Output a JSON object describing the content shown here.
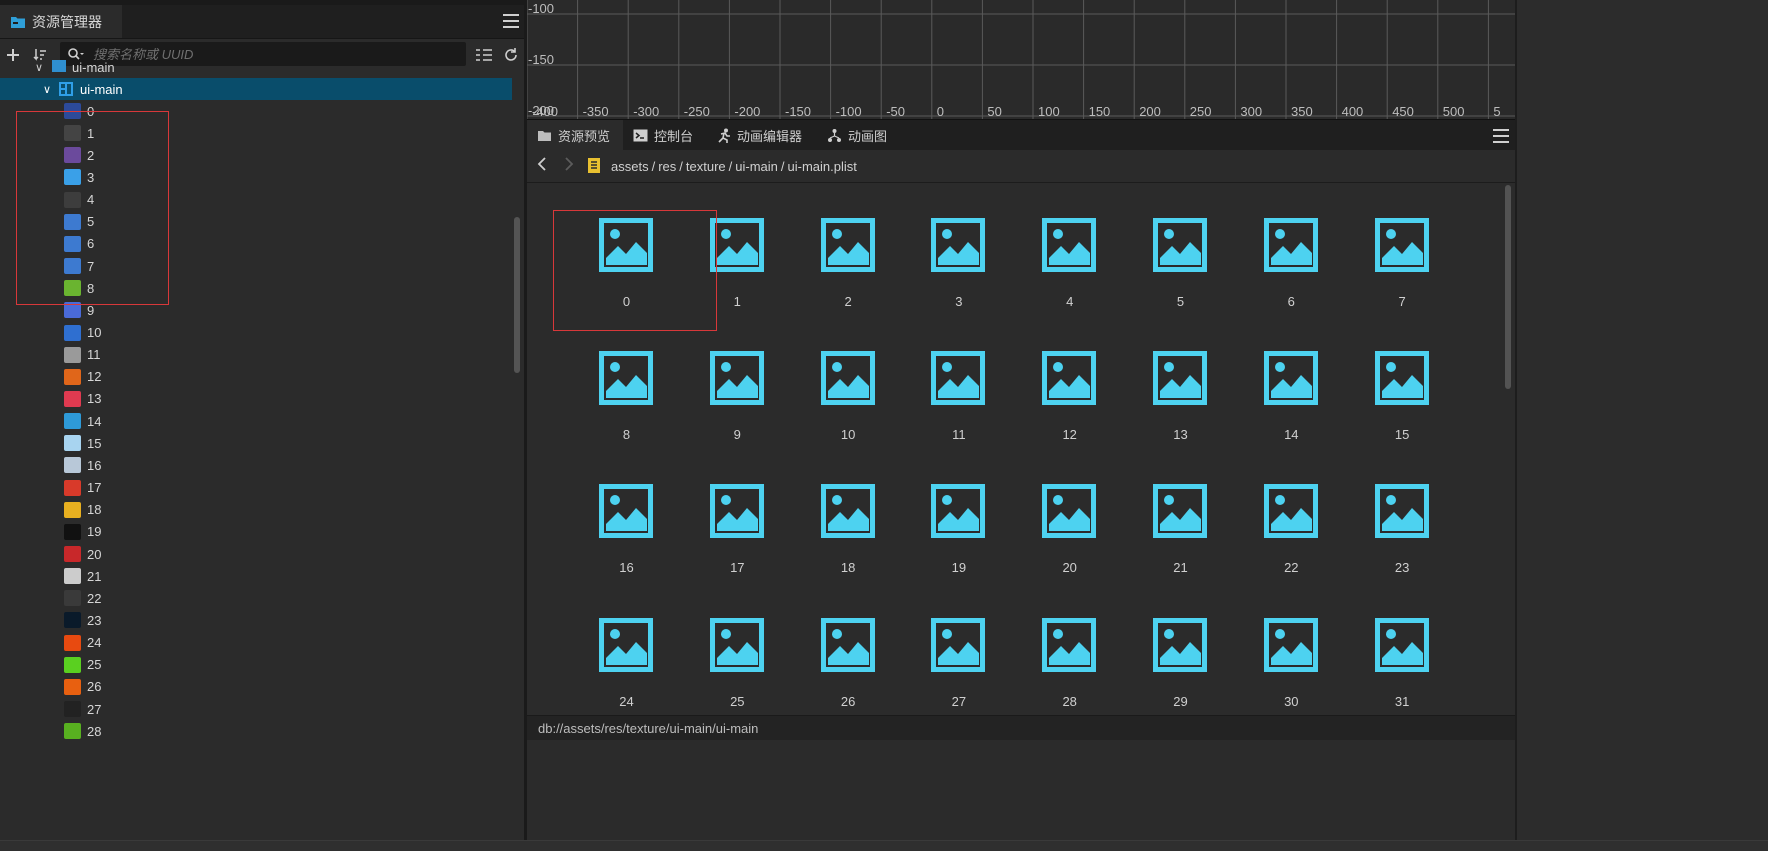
{
  "explorer": {
    "tab_title": "资源管理器",
    "search_placeholder": "搜索名称或 UUID",
    "partial_row_label": "ui-main",
    "selected_label": "ui-main",
    "items": [
      {
        "label": "0",
        "thumb": "#2c4a9a"
      },
      {
        "label": "1",
        "thumb": "#444444"
      },
      {
        "label": "2",
        "thumb": "#6b4a9c"
      },
      {
        "label": "3",
        "thumb": "#3aa0e8"
      },
      {
        "label": "4",
        "thumb": "#3d3d3d"
      },
      {
        "label": "5",
        "thumb": "#3d7ad0"
      },
      {
        "label": "6",
        "thumb": "#3d7ad0"
      },
      {
        "label": "7",
        "thumb": "#3d7ad0"
      },
      {
        "label": "8",
        "thumb": "#6ab430"
      },
      {
        "label": "9",
        "thumb": "#4a6ad8"
      },
      {
        "label": "10",
        "thumb": "#2f6fd0"
      },
      {
        "label": "11",
        "thumb": "#9a9a9a"
      },
      {
        "label": "12",
        "thumb": "#e0661a"
      },
      {
        "label": "13",
        "thumb": "#e03a50"
      },
      {
        "label": "14",
        "thumb": "#2e9ad8"
      },
      {
        "label": "15",
        "thumb": "#a8d4f0"
      },
      {
        "label": "16",
        "thumb": "#b8c8d8"
      },
      {
        "label": "17",
        "thumb": "#d83a2a"
      },
      {
        "label": "18",
        "thumb": "#e8b020"
      },
      {
        "label": "19",
        "thumb": "#111111"
      },
      {
        "label": "20",
        "thumb": "#c8282a"
      },
      {
        "label": "21",
        "thumb": "#cccccc"
      },
      {
        "label": "22",
        "thumb": "#3a3a3a"
      },
      {
        "label": "23",
        "thumb": "#0a1a2a"
      },
      {
        "label": "24",
        "thumb": "#e84a10"
      },
      {
        "label": "25",
        "thumb": "#5ad020"
      },
      {
        "label": "26",
        "thumb": "#e86010"
      },
      {
        "label": "27",
        "thumb": "#222222"
      },
      {
        "label": "28",
        "thumb": "#58b020"
      }
    ]
  },
  "scene": {
    "y_labels": [
      "-100",
      "-150",
      "-200"
    ],
    "x_labels": [
      "-400",
      "-350",
      "-300",
      "-250",
      "-200",
      "-150",
      "-100",
      "-50",
      "0",
      "50",
      "100",
      "150",
      "200",
      "250",
      "300",
      "350",
      "400",
      "450",
      "500",
      "5"
    ]
  },
  "preview": {
    "tabs": [
      {
        "label": "资源预览",
        "icon": "folder-icon"
      },
      {
        "label": "控制台",
        "icon": "terminal-icon"
      },
      {
        "label": "动画编辑器",
        "icon": "runner-icon"
      },
      {
        "label": "动画图",
        "icon": "graph-icon"
      }
    ],
    "breadcrumb": [
      "assets",
      "res",
      "texture",
      "ui-main",
      "ui-main.plist"
    ],
    "separator": "/",
    "assets": [
      "0",
      "1",
      "2",
      "3",
      "4",
      "5",
      "6",
      "7",
      "8",
      "9",
      "10",
      "11",
      "12",
      "13",
      "14",
      "15",
      "16",
      "17",
      "18",
      "19",
      "20",
      "21",
      "22",
      "23",
      "24",
      "25",
      "26",
      "27",
      "28",
      "29",
      "30",
      "31"
    ],
    "status_path": "db://assets/res/texture/ui-main/ui-main",
    "accent": "#4dd2f0"
  }
}
